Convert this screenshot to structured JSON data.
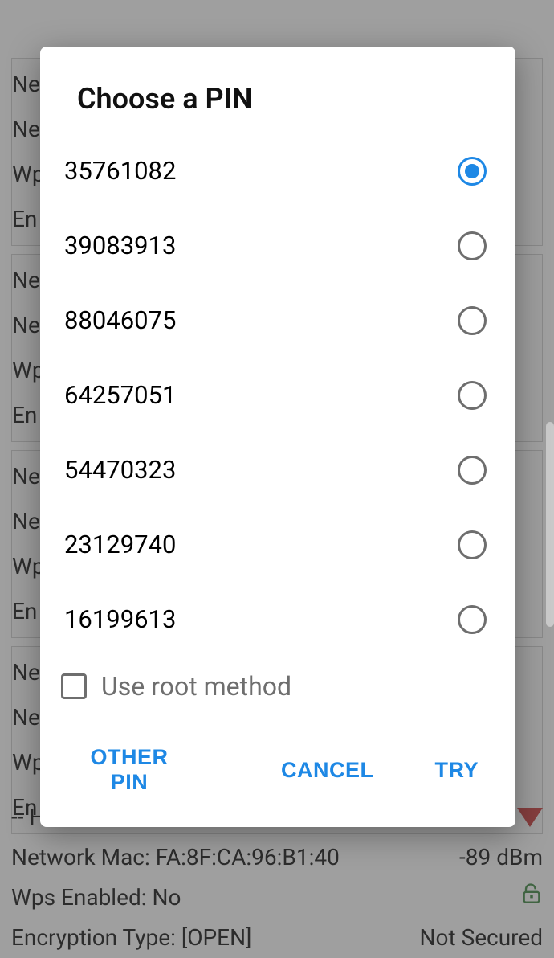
{
  "dialog": {
    "title": "Choose a PIN",
    "pins": [
      {
        "value": "35761082",
        "selected": true
      },
      {
        "value": "39083913",
        "selected": false
      },
      {
        "value": "88046075",
        "selected": false
      },
      {
        "value": "64257051",
        "selected": false
      },
      {
        "value": "54470323",
        "selected": false
      },
      {
        "value": "23129740",
        "selected": false
      },
      {
        "value": "16199613",
        "selected": false
      }
    ],
    "root_checkbox": {
      "label": "Use root method",
      "checked": false
    },
    "buttons": {
      "other_pin": "OTHER PIN",
      "cancel": "CANCEL",
      "try": "TRY"
    }
  },
  "background": {
    "card_rows": [
      "Ne",
      "Ne",
      "Wp",
      "En"
    ],
    "detail": {
      "name": "-- Hidden network --",
      "mac_label": "Network Mac:",
      "mac": "FA:8F:CA:96:B1:40",
      "signal": "-89 dBm",
      "wps_label": "Wps Enabled:",
      "wps": "No",
      "enc_label": "Encryption Type:",
      "enc": "[OPEN]",
      "sec_label": "Not Secured"
    }
  },
  "colors": {
    "accent": "#1e88e5",
    "danger": "#c62828",
    "unlock": "#2e7d32"
  }
}
